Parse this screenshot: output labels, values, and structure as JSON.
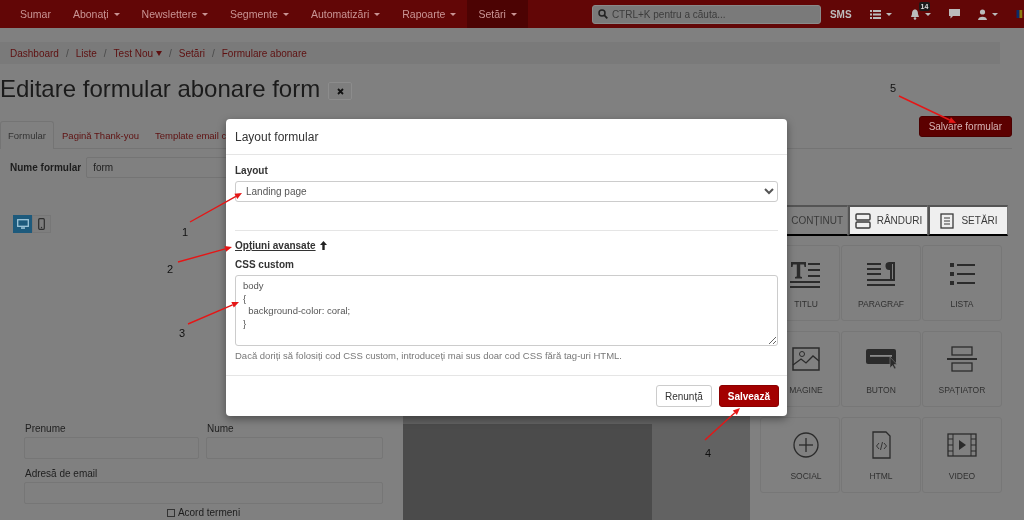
{
  "navbar": {
    "menu": [
      {
        "label": "Sumar",
        "dropdown": false,
        "selected": false
      },
      {
        "label": "Abonați",
        "dropdown": true,
        "selected": false
      },
      {
        "label": "Newslettere",
        "dropdown": true,
        "selected": false
      },
      {
        "label": "Segmente",
        "dropdown": true,
        "selected": false
      },
      {
        "label": "Automatizări",
        "dropdown": true,
        "selected": false
      },
      {
        "label": "Rapoarte",
        "dropdown": true,
        "selected": false
      },
      {
        "label": "Setări",
        "dropdown": true,
        "selected": true
      }
    ],
    "search": {
      "placeholder": "CTRL+K pentru a căuta..."
    },
    "sms": "SMS",
    "notifications_badge": "14"
  },
  "breadcrumb": {
    "separator": "/",
    "items": [
      {
        "label": "Dashboard",
        "dropdown": false
      },
      {
        "label": "Liste",
        "dropdown": false
      },
      {
        "label": "Test Nou",
        "dropdown": true
      },
      {
        "label": "Setări",
        "dropdown": false
      },
      {
        "label": "Formulare abonare",
        "dropdown": false
      }
    ]
  },
  "page": {
    "title": "Editare formular abonare form",
    "save_button": "Salvare formular",
    "tabs": [
      {
        "label": "Formular",
        "selected": true
      },
      {
        "label": "Pagină Thank-you",
        "selected": false
      },
      {
        "label": "Template email c",
        "selected": false
      }
    ],
    "name_label": "Nume formular",
    "name_value": "form"
  },
  "device_toggle": [
    {
      "kind": "desktop",
      "selected": true
    },
    {
      "kind": "mobile",
      "selected": false
    }
  ],
  "form_fields": [
    {
      "label": "Prenume"
    },
    {
      "label": "Nume"
    },
    {
      "label": "Adresă de email"
    }
  ],
  "consent": {
    "label": "Acord termeni",
    "checked": false
  },
  "builder_tabs": [
    {
      "label": "CONȚINUT",
      "kind": "content",
      "selected": true
    },
    {
      "label": "RÂNDURI",
      "kind": "rows",
      "selected": false
    },
    {
      "label": "SETĂRI",
      "kind": "settings",
      "selected": false
    }
  ],
  "blocks": [
    {
      "label": "TITLU",
      "kind": "title"
    },
    {
      "label": "PARAGRAF",
      "kind": "paragraph"
    },
    {
      "label": "LISTA",
      "kind": "list"
    },
    {
      "label": "MAGINE",
      "kind": "image"
    },
    {
      "label": "BUTON",
      "kind": "button"
    },
    {
      "label": "SPAȚIATOR",
      "kind": "spacer"
    },
    {
      "label": "SOCIAL",
      "kind": "social"
    },
    {
      "label": "HTML",
      "kind": "html"
    },
    {
      "label": "VIDEO",
      "kind": "video"
    }
  ],
  "modal": {
    "title": "Layout formular",
    "layout_label": "Layout",
    "layout_value": "Landing page",
    "advanced_link": "Opțiuni avansate",
    "css_label": "CSS custom",
    "css_value": "body\n{\n  background-color: coral;\n}",
    "help": "Dacă doriți să folosiți cod CSS custom, introduceți mai sus doar cod CSS fără tag-uri HTML.",
    "cancel_button": "Renunță",
    "save_button": "Salvează"
  },
  "annotations": [
    {
      "label": "1"
    },
    {
      "label": "2"
    },
    {
      "label": "3"
    },
    {
      "label": "4"
    },
    {
      "label": "5"
    }
  ]
}
